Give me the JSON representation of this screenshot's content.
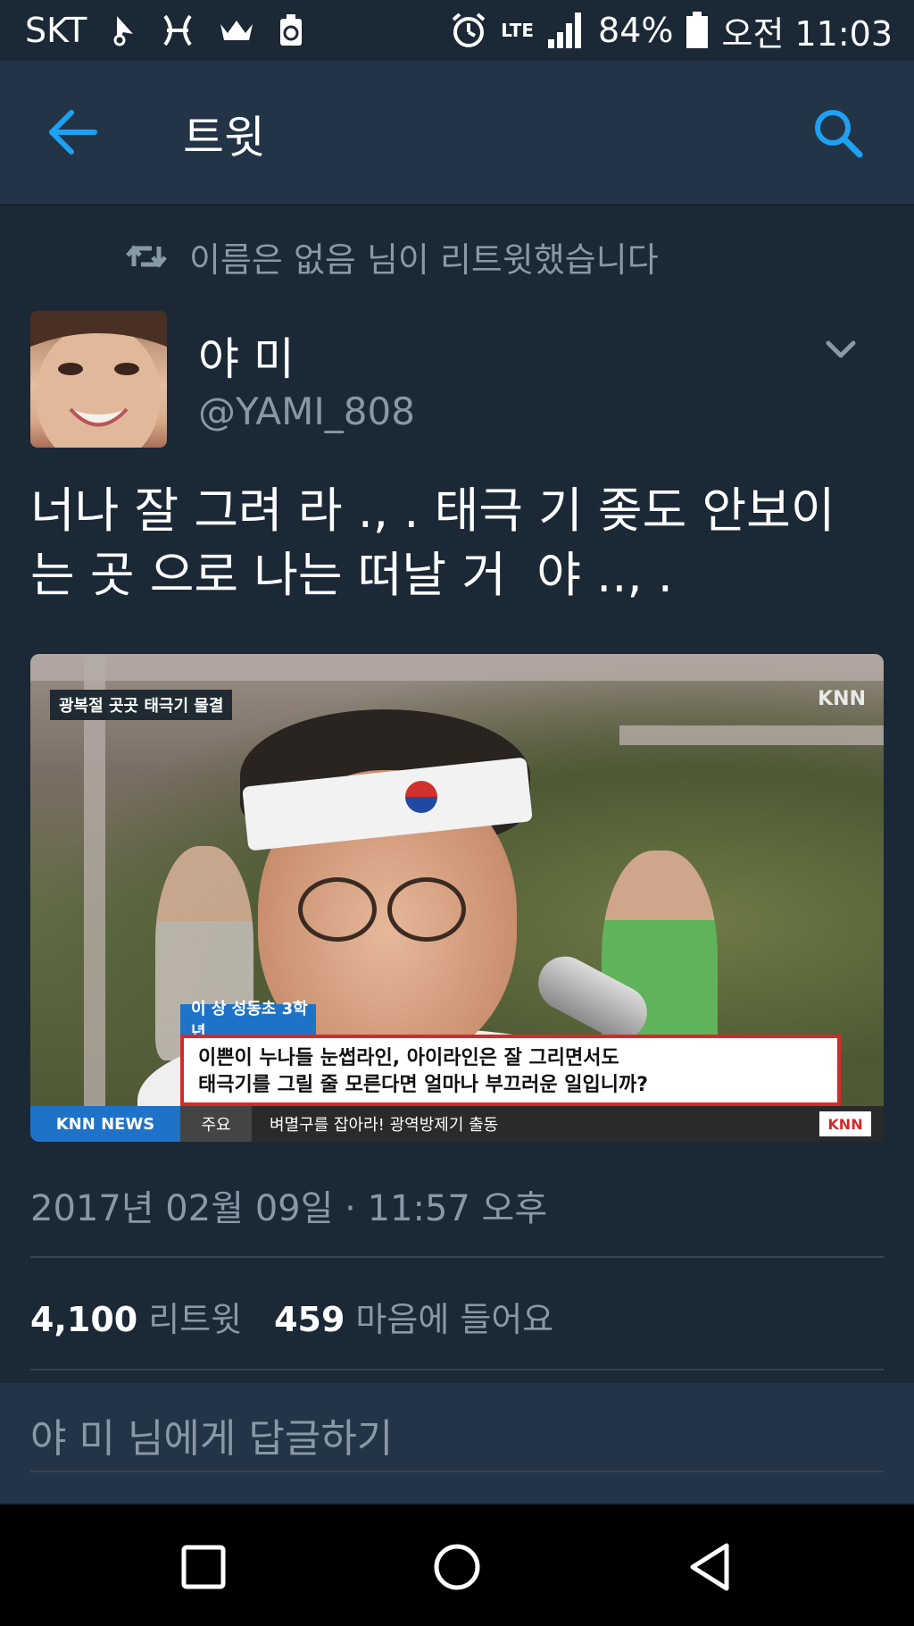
{
  "status_bar": {
    "carrier": "SKT",
    "network": "LTE",
    "battery": "84%",
    "time": "오전 11:03",
    "icons": [
      "navigation-icon",
      "pisces-icon",
      "crown-icon",
      "recycle-icon",
      "alarm-icon",
      "lte-icon",
      "signal-icon",
      "battery-icon"
    ]
  },
  "app_bar": {
    "title": "트윗",
    "back_icon": "arrow-left-icon",
    "search_icon": "search-icon",
    "accent_color": "#1da1f2"
  },
  "retweet_context": {
    "text": "이름은 없음 님이 리트윗했습니다",
    "icon": "retweet-icon"
  },
  "tweet": {
    "author_name": "야 미",
    "author_handle": "@YAMI_808",
    "text": "너나 잘 그려 라 ., . 태극 기 좆도 안보이\n는 곳 으로 나는 떠날 거  야 .., .",
    "timestamp": "2017년 02월 09일 · 11:57 오후",
    "retweet_count": "4,100",
    "retweet_label": "리트윗",
    "like_count": "459",
    "like_label": "마음에 들어요"
  },
  "media": {
    "top_caption": "광복절 곳곳 태극기 물결",
    "channel_logo": "KNN",
    "name_tag": "이 상  성동초 3학년",
    "subtitle": "이쁜이 누나들 눈썹라인, 아이라인은 잘 그리면서도\n태극기를 그릴 줄 모른다면 얼마나 부끄러운 일입니까?",
    "ticker_brand": "KNN NEWS",
    "ticker_tag": "주요",
    "ticker_text": "벼멸구를 잡아라! 광역방제기 출동",
    "ticker_logo": "KNN"
  },
  "reply": {
    "placeholder": "야 미 님에게 답글하기"
  },
  "nav_bar": {
    "icons": [
      "recent-apps-icon",
      "home-icon",
      "back-triangle-icon"
    ]
  }
}
